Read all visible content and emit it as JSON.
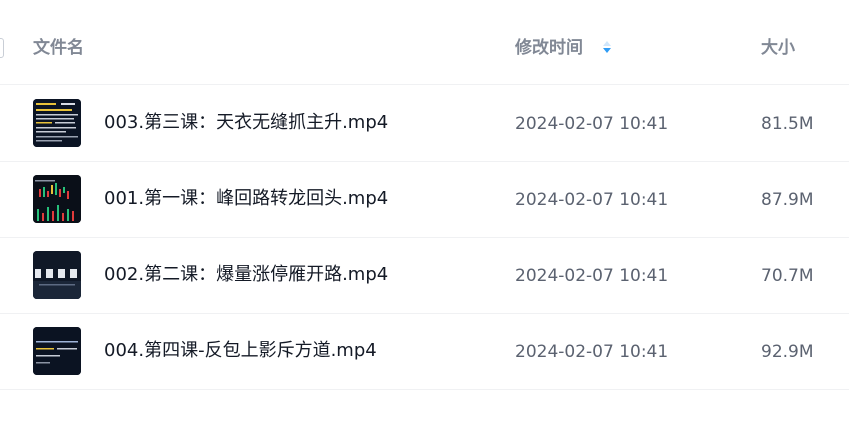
{
  "header": {
    "name_label": "文件名",
    "time_label": "修改时间",
    "size_label": "大小",
    "sort_icon": "sort-descending-icon",
    "sort_color": "#2f9cf5"
  },
  "files": [
    {
      "name": "003.第三课：天衣无缝抓主升.mp4",
      "modified": "2024-02-07 10:41",
      "size": "81.5M",
      "thumb": "video-thumbnail-text-icon"
    },
    {
      "name": "001.第一课：峰回路转龙回头.mp4",
      "modified": "2024-02-07 10:41",
      "size": "87.9M",
      "thumb": "video-thumbnail-candlestick-icon"
    },
    {
      "name": "002.第二课：爆量涨停雁开路.mp4",
      "modified": "2024-02-07 10:41",
      "size": "70.7M",
      "thumb": "video-thumbnail-title-card-icon"
    },
    {
      "name": "004.第四课-反包上影斥方道.mp4",
      "modified": "2024-02-07 10:41",
      "size": "92.9M",
      "thumb": "video-thumbnail-text-icon"
    }
  ]
}
